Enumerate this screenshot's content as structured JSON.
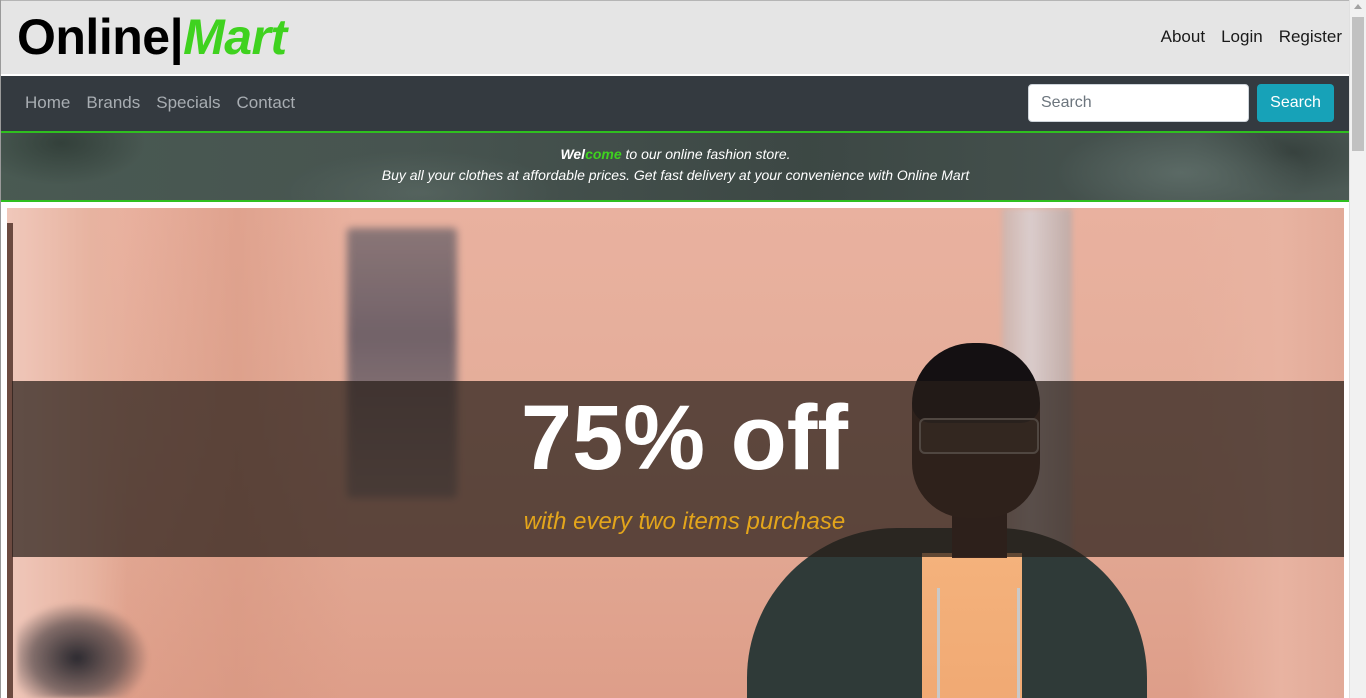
{
  "header": {
    "logo_part1": "Online",
    "logo_separator": "|",
    "logo_part2": "Mart",
    "links": [
      "About",
      "Login",
      "Register"
    ]
  },
  "nav": {
    "items": [
      "Home",
      "Brands",
      "Specials",
      "Contact"
    ],
    "search": {
      "placeholder": "Search",
      "value": "",
      "button_label": "Search"
    }
  },
  "welcome": {
    "highlight_a": "Wel",
    "highlight_b": "come",
    "line1_rest": " to our online fashion store.",
    "line2": "Buy all your clothes at affordable prices. Get fast delivery at your convenience with Online Mart"
  },
  "promo": {
    "title": "75% off",
    "subtitle": "with every two items purchase"
  },
  "colors": {
    "brand_green": "#3fd21f",
    "navbar_bg": "#343a40",
    "search_button": "#17a2b8",
    "promo_subtitle": "#e3a51b"
  }
}
